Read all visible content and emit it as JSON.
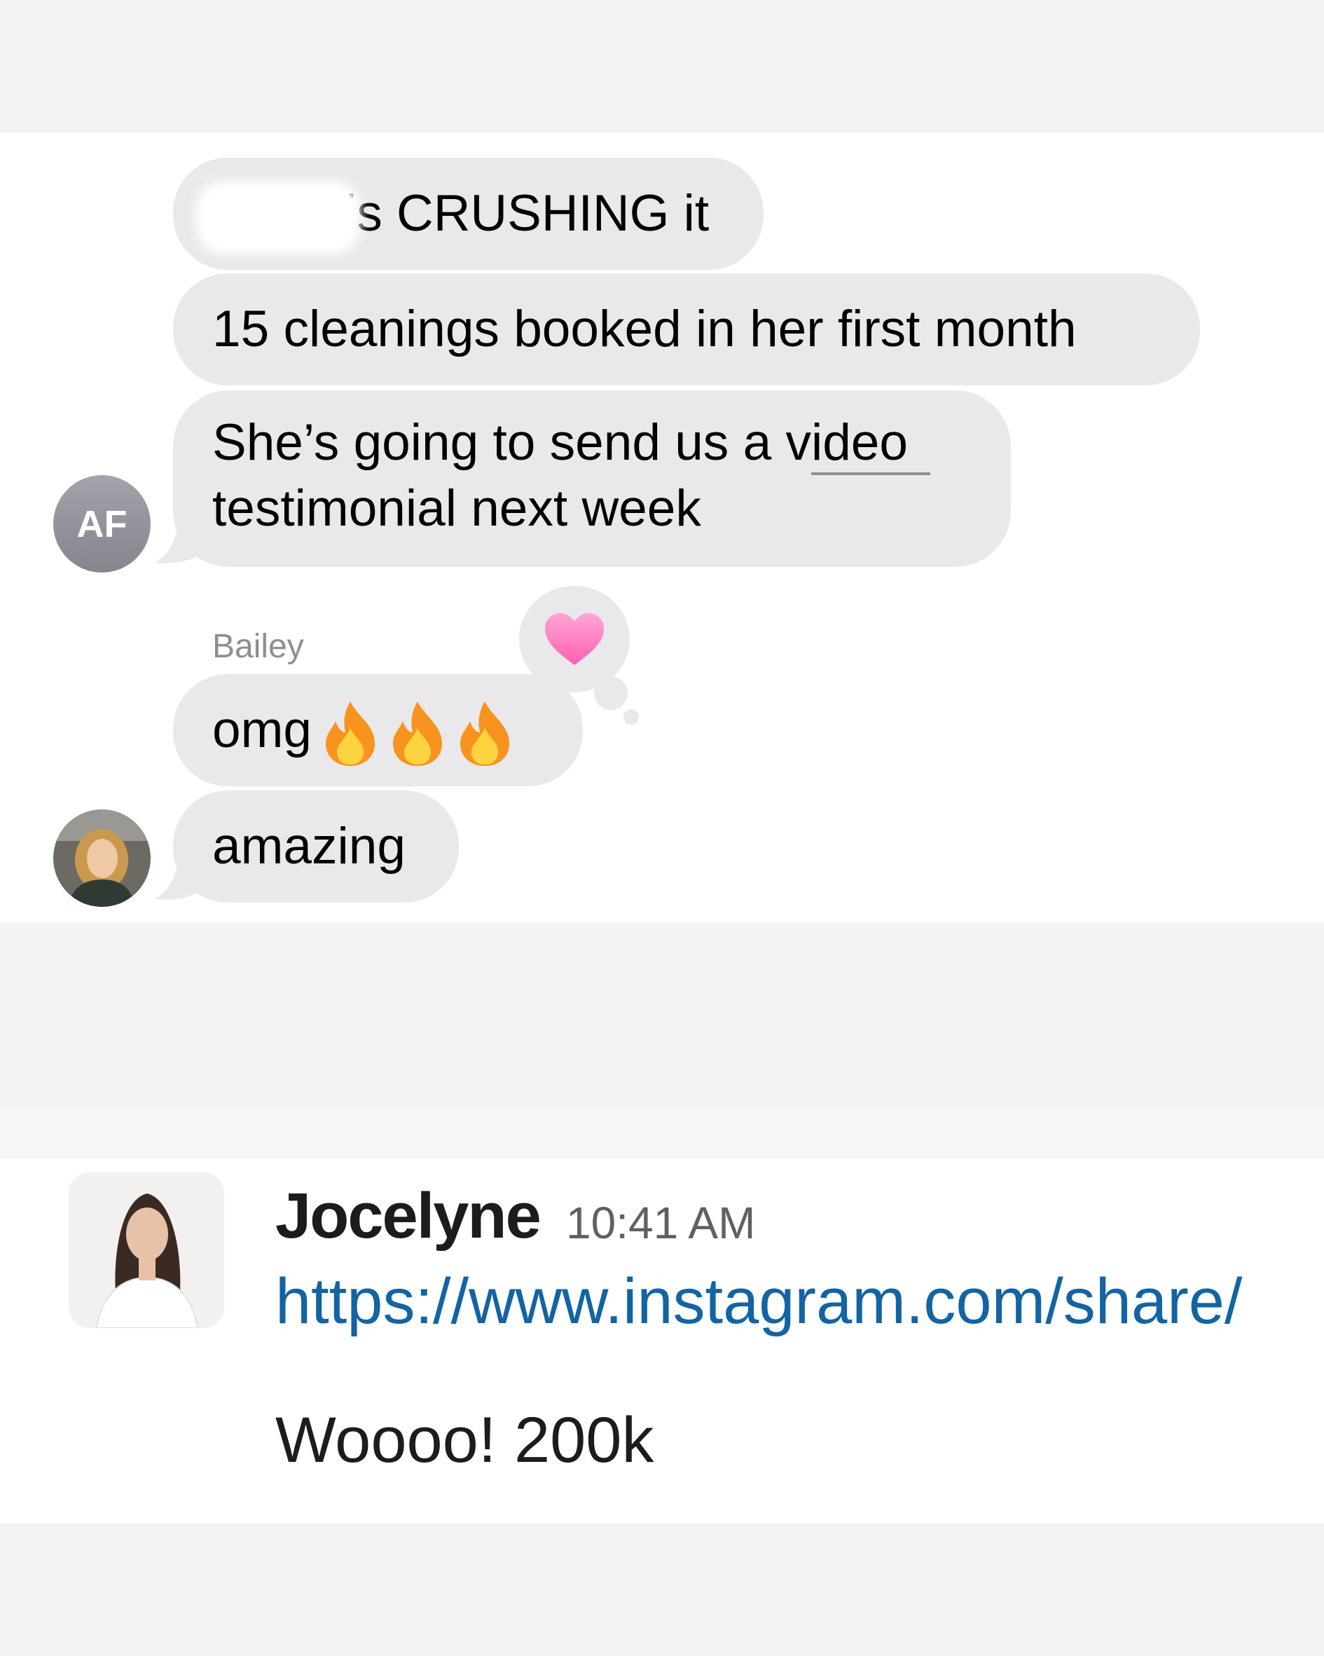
{
  "imessage": {
    "messages": [
      {
        "text": "is CRUSHING it",
        "redacted_prefix": true
      },
      {
        "text": "15 cleanings booked in her first month"
      },
      {
        "text_line1": "She’s going to send us a video",
        "text_line2": "testimonial next week"
      },
      {
        "text": "omg",
        "emoji": "fire-emoji x3"
      },
      {
        "text": "amazing"
      }
    ],
    "avatar_initials": "AF",
    "sender_name": "Bailey",
    "reaction": "heart-reaction",
    "colors": {
      "bubble": "#e9e9eb",
      "heart": "#ff7fbf",
      "avatar_bg": "#8e8e93"
    }
  },
  "slack": {
    "author": "Jocelyne",
    "time": "10:41 AM",
    "link": "https://www.instagram.com/share/",
    "message": "Woooo! 200k",
    "colors": {
      "link": "#1264a3",
      "text": "#1d1c1d"
    }
  }
}
